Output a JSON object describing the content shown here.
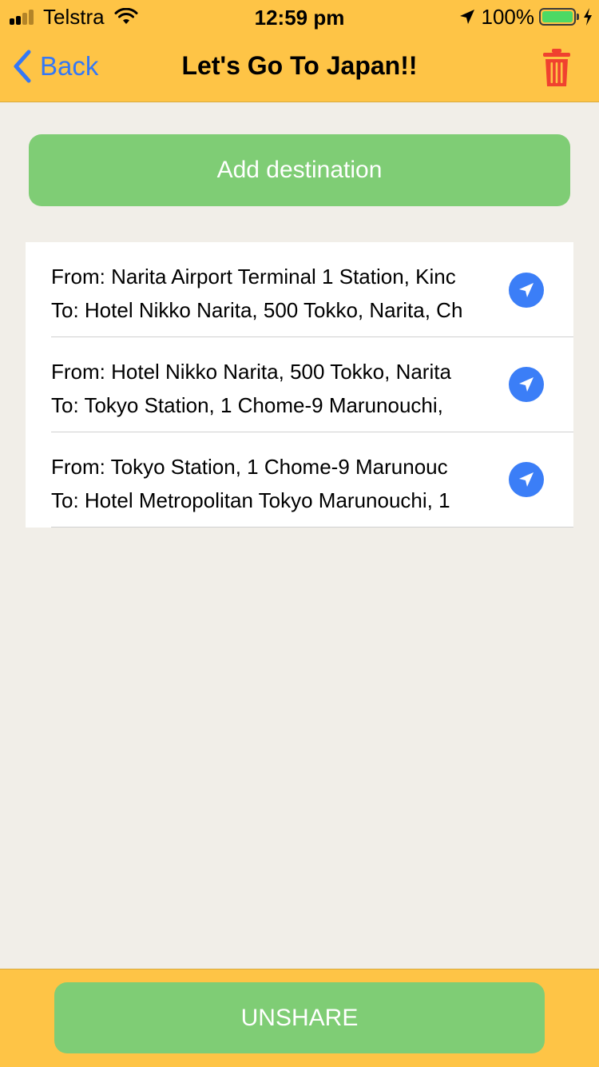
{
  "status_bar": {
    "carrier": "Telstra",
    "time": "12:59 pm",
    "battery_percent": "100%"
  },
  "nav": {
    "back_label": "Back",
    "title": "Let's Go To Japan!!"
  },
  "add_button_label": "Add destination",
  "routes": [
    {
      "from": "From: Narita Airport Terminal 1 Station, Kinc",
      "to": "To: Hotel Nikko Narita, 500 Tokko, Narita, Ch"
    },
    {
      "from": "From: Hotel Nikko Narita, 500 Tokko, Narita",
      "to": "To: Tokyo Station, 1 Chome-9 Marunouchi,"
    },
    {
      "from": "From: Tokyo Station, 1 Chome-9 Marunouc",
      "to": "To: Hotel Metropolitan Tokyo Marunouchi, 1"
    }
  ],
  "unshare_label": "UNSHARE",
  "colors": {
    "bar_yellow": "#fec446",
    "button_green": "#7fcd75",
    "accent_blue": "#3478f6",
    "trash_red": "#f0412f",
    "background": "#f1eee8"
  },
  "icons": [
    "signal-icon",
    "wifi-icon",
    "location-arrow-icon",
    "battery-icon",
    "charging-bolt-icon",
    "chevron-left-icon",
    "trash-icon",
    "navigate-icon"
  ]
}
